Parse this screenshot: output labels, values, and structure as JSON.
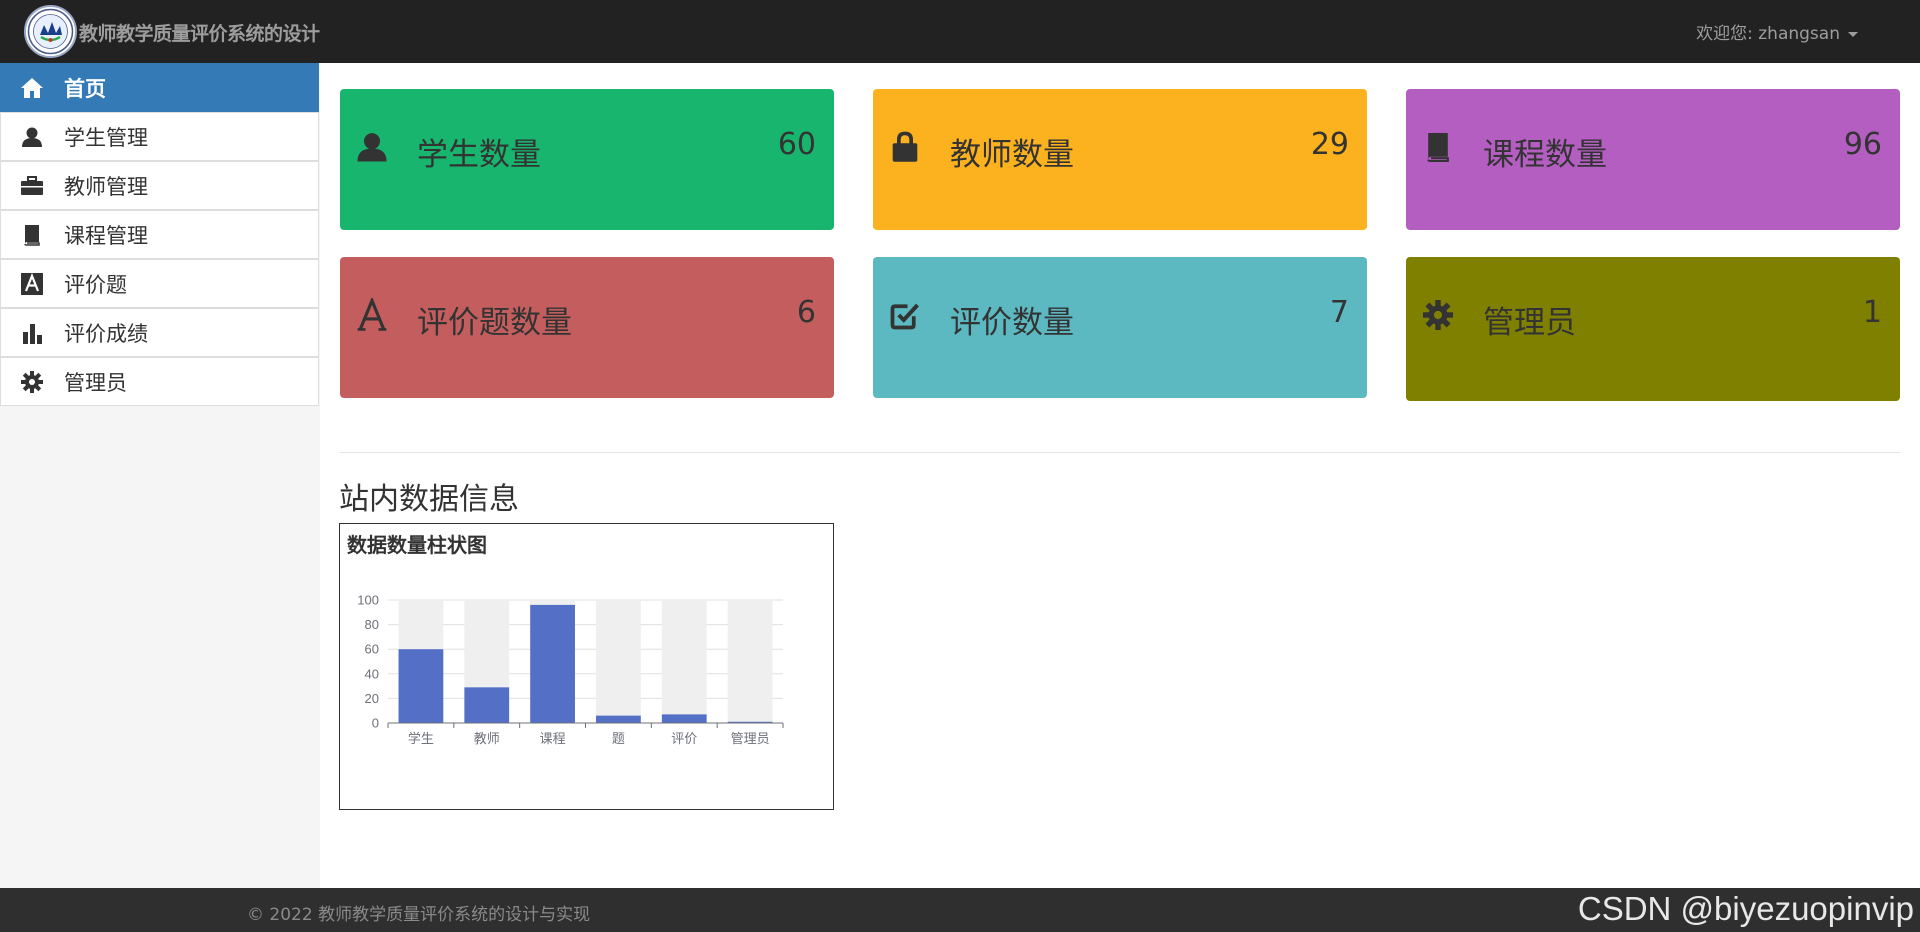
{
  "header": {
    "brand": "教师教学质量评价系统的设计",
    "welcome": "欢迎您: zhangsan"
  },
  "sidebar": {
    "items": [
      {
        "label": "首页",
        "icon": "home-icon",
        "active": true
      },
      {
        "label": "学生管理",
        "icon": "user-icon",
        "active": false
      },
      {
        "label": "教师管理",
        "icon": "briefcase-icon",
        "active": false
      },
      {
        "label": "课程管理",
        "icon": "book-icon",
        "active": false
      },
      {
        "label": "评价题",
        "icon": "font-icon",
        "active": false
      },
      {
        "label": "评价成绩",
        "icon": "stats-icon",
        "active": false
      },
      {
        "label": "管理员",
        "icon": "gear-icon",
        "active": false
      }
    ]
  },
  "cards": [
    {
      "label": "学生数量",
      "value": "60",
      "color": "#18b56e",
      "icon": "user-icon"
    },
    {
      "label": "教师数量",
      "value": "29",
      "color": "#fbb21e",
      "icon": "lock-icon"
    },
    {
      "label": "课程数量",
      "value": "96",
      "color": "#b45ec2",
      "icon": "book-icon"
    },
    {
      "label": "评价题数量",
      "value": "6",
      "color": "#c45e5e",
      "icon": "font-icon"
    },
    {
      "label": "评价数量",
      "value": "7",
      "color": "#5cb9c2",
      "icon": "check-icon"
    },
    {
      "label": "管理员",
      "value": "1",
      "color": "#808000",
      "icon": "gear-icon"
    }
  ],
  "section": {
    "title": "站内数据信息"
  },
  "chart_data": {
    "type": "bar",
    "title": "数据数量柱状图",
    "categories": [
      "学生",
      "教师",
      "课程",
      "题",
      "评价",
      "管理员"
    ],
    "values": [
      60,
      29,
      96,
      6,
      7,
      1
    ],
    "ylim": [
      0,
      100
    ],
    "yticks": [
      0,
      20,
      40,
      60,
      80,
      100
    ],
    "grid": true,
    "background_bars": true,
    "bar_color": "#5470c6",
    "background_color": "#efefef"
  },
  "footer": {
    "copyright": "© 2022 教师教学质量评价系统的设计与实现",
    "watermark": "CSDN @biyezuopinvip"
  }
}
